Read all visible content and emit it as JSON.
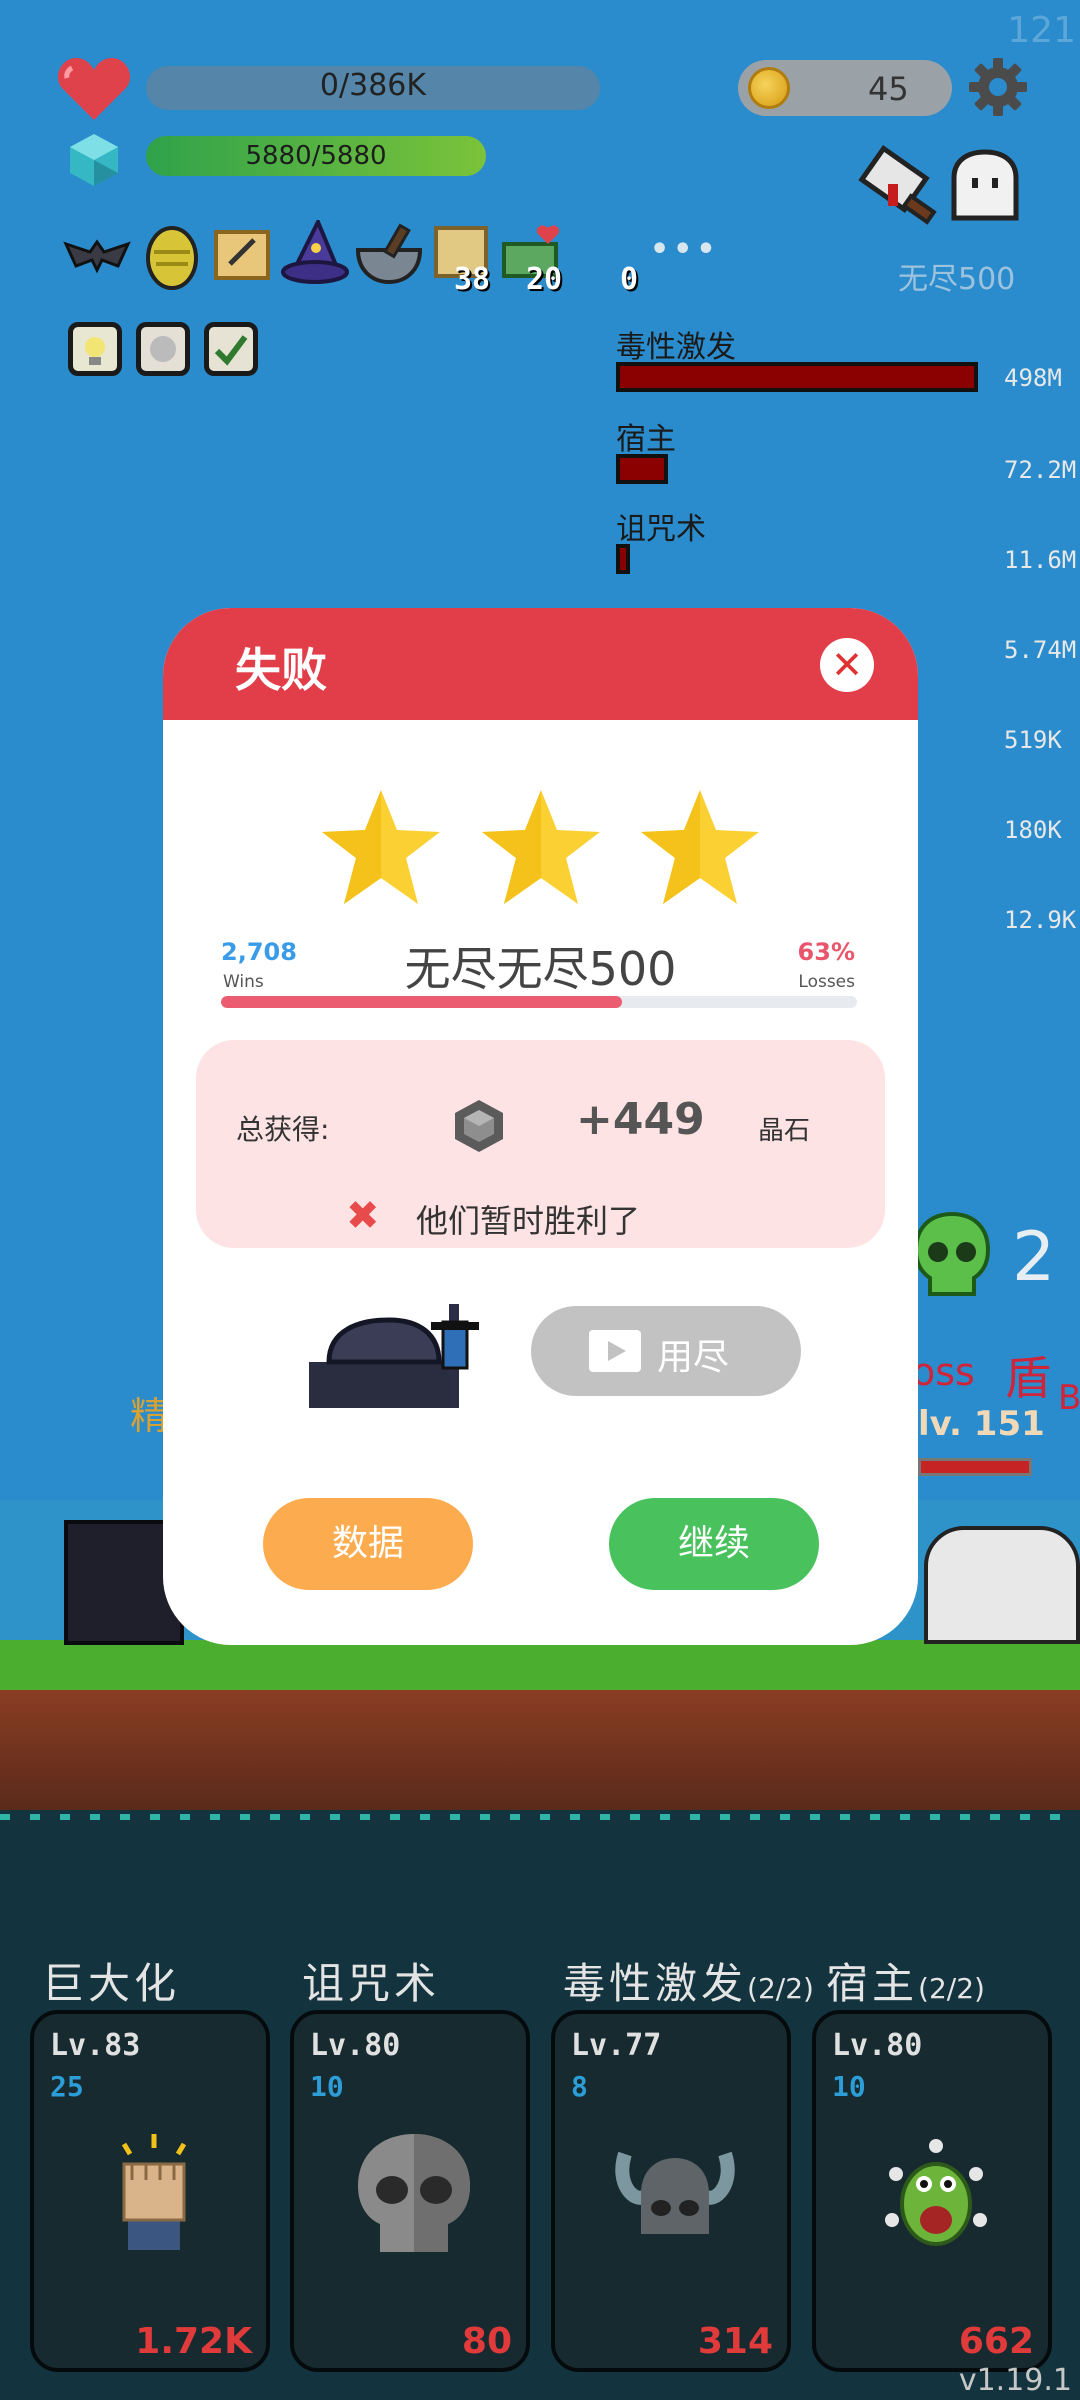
{
  "hud": {
    "top_right_number": "121",
    "hp_text": "0/386K",
    "hp_fraction": 0.0,
    "shield_text": "5880/5880",
    "shield_fraction": 1.0,
    "coins": "45",
    "item_counts": {
      "map": "38",
      "money": "20",
      "misc": "0"
    },
    "mode_label": "无尽500"
  },
  "damage_list": [
    {
      "name": "毒性激发",
      "value": "498M",
      "fraction": 1.0
    },
    {
      "name": "宿主",
      "value": "72.2M",
      "fraction": 0.145
    },
    {
      "name": "诅咒术",
      "value": "11.6M",
      "fraction": 0.023
    },
    {
      "name": "",
      "value": "5.74M",
      "fraction": 0.0
    },
    {
      "name": "",
      "value": "519K",
      "fraction": 0.0
    },
    {
      "name": "",
      "value": "180K",
      "fraction": 0.0
    },
    {
      "name": "",
      "value": "12.9K",
      "fraction": 0.0
    }
  ],
  "scene": {
    "enemy_count": "2",
    "boss_text": "oss",
    "shield_text": "盾",
    "boss_level": "lv. 151",
    "left_text": "精"
  },
  "modal": {
    "title": "失败",
    "close_icon": "close-icon",
    "stars": 3,
    "wins": "2,708",
    "wins_label": "Wins",
    "losses_pct": "63%",
    "losses_label": "Losses",
    "mode_name": "无尽无尽500",
    "progress_fraction": 0.63,
    "reward_label": "总获得:",
    "reward_amount": "+449",
    "reward_unit": "晶石",
    "result_message": "他们暂时胜利了",
    "ad_button": "用尽",
    "stats_button": "数据",
    "continue_button": "继续",
    "colors": {
      "header": "#e23e4a",
      "stats": "#fcac4f",
      "continue": "#49c25d"
    }
  },
  "skills": [
    {
      "name": "巨大化",
      "sub": "",
      "level": "Lv.83",
      "count": "25",
      "damage": "1.72K",
      "icon": "fist-icon"
    },
    {
      "name": "诅咒术",
      "sub": "",
      "level": "Lv.80",
      "count": "10",
      "damage": "80",
      "icon": "skull-icon"
    },
    {
      "name": "毒性激发",
      "sub": "(2/2)",
      "level": "Lv.77",
      "count": "8",
      "damage": "314",
      "icon": "horned-helmet-icon"
    },
    {
      "name": "宿主",
      "sub": "(2/2)",
      "level": "Lv.80",
      "count": "10",
      "damage": "662",
      "icon": "green-monster-icon"
    }
  ],
  "version": "v1.19.1"
}
